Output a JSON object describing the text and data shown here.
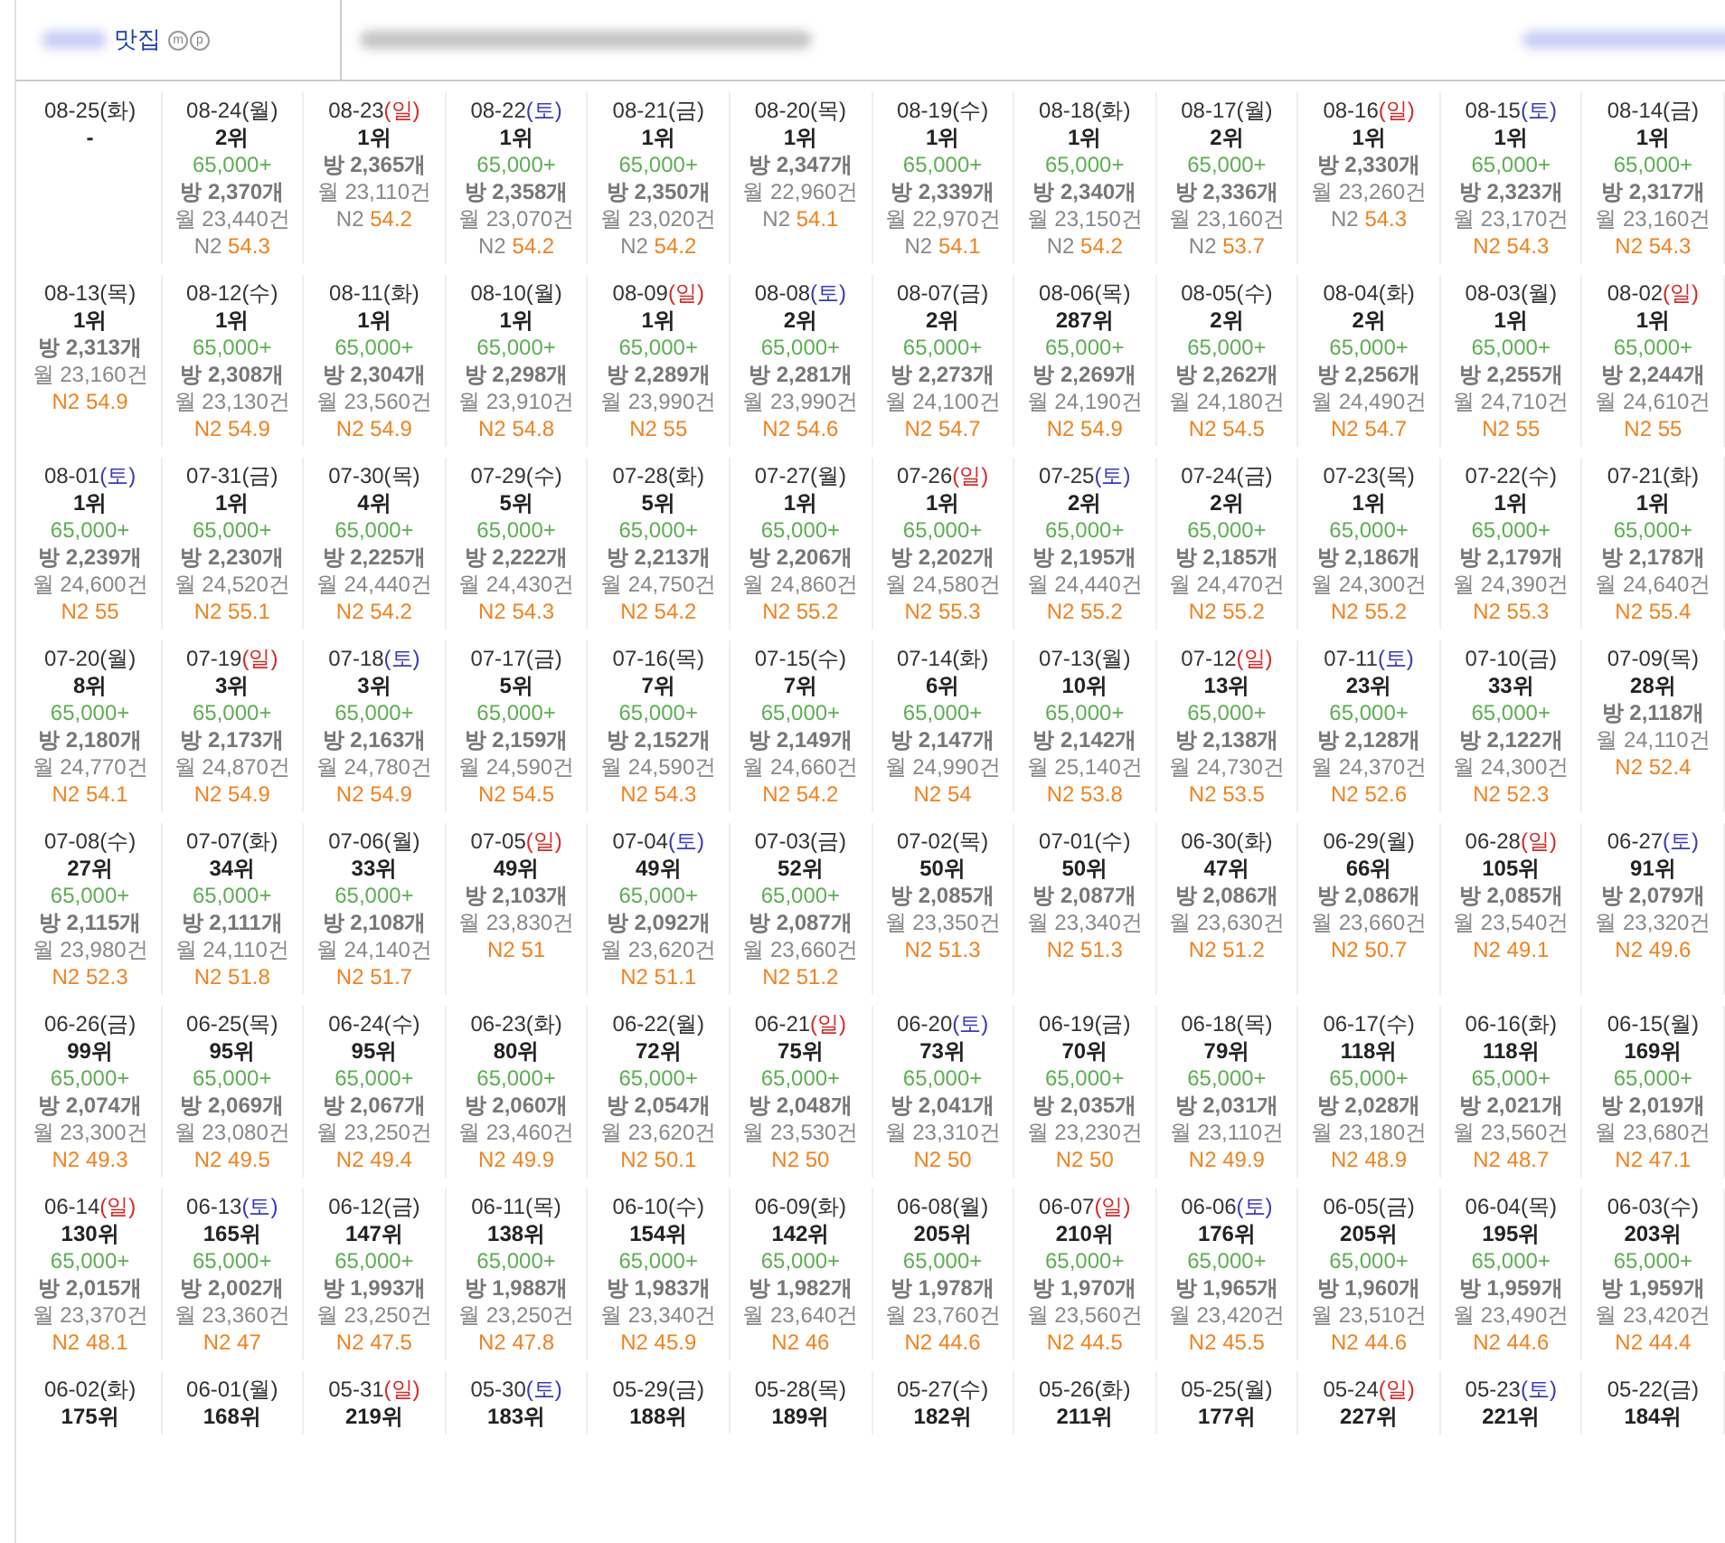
{
  "header": {
    "title": "맛집",
    "badges": [
      "m",
      "p"
    ]
  },
  "rows": [
    {
      "cells": [
        {
          "date": "08-25",
          "day": "(화)",
          "kind": "weekday",
          "rank": "-"
        },
        {
          "date": "08-24",
          "day": "(월)",
          "kind": "weekday",
          "rank": "2위",
          "price": "65,000+",
          "rooms": "방 2,370개",
          "monthly": "월 23,440건",
          "n2_label": "N2",
          "n2": "54.3",
          "n2_highlight": false
        },
        {
          "date": "08-23",
          "day": "(일)",
          "kind": "sun",
          "rank": "1위",
          "rooms": "방 2,365개",
          "monthly": "월 23,110건",
          "n2_label": "N2",
          "n2": "54.2",
          "n2_highlight": false
        },
        {
          "date": "08-22",
          "day": "(토)",
          "kind": "sat",
          "rank": "1위",
          "price": "65,000+",
          "rooms": "방 2,358개",
          "monthly": "월 23,070건",
          "n2_label": "N2",
          "n2": "54.2",
          "n2_highlight": false
        },
        {
          "date": "08-21",
          "day": "(금)",
          "kind": "weekday",
          "rank": "1위",
          "price": "65,000+",
          "rooms": "방 2,350개",
          "monthly": "월 23,020건",
          "n2_label": "N2",
          "n2": "54.2",
          "n2_highlight": false
        },
        {
          "date": "08-20",
          "day": "(목)",
          "kind": "weekday",
          "rank": "1위",
          "rooms": "방 2,347개",
          "monthly": "월 22,960건",
          "n2_label": "N2",
          "n2": "54.1",
          "n2_highlight": false
        },
        {
          "date": "08-19",
          "day": "(수)",
          "kind": "weekday",
          "rank": "1위",
          "price": "65,000+",
          "rooms": "방 2,339개",
          "monthly": "월 22,970건",
          "n2_label": "N2",
          "n2": "54.1",
          "n2_highlight": false
        },
        {
          "date": "08-18",
          "day": "(화)",
          "kind": "weekday",
          "rank": "1위",
          "price": "65,000+",
          "rooms": "방 2,340개",
          "monthly": "월 23,150건",
          "n2_label": "N2",
          "n2": "54.2",
          "n2_highlight": false
        },
        {
          "date": "08-17",
          "day": "(월)",
          "kind": "weekday",
          "rank": "2위",
          "price": "65,000+",
          "rooms": "방 2,336개",
          "monthly": "월 23,160건",
          "n2_label": "N2",
          "n2": "53.7",
          "n2_highlight": false
        },
        {
          "date": "08-16",
          "day": "(일)",
          "kind": "sun",
          "rank": "1위",
          "rooms": "방 2,330개",
          "monthly": "월 23,260건",
          "n2_label": "N2",
          "n2": "54.3",
          "n2_highlight": false
        },
        {
          "date": "08-15",
          "day": "(토)",
          "kind": "sat",
          "rank": "1위",
          "price": "65,000+",
          "rooms": "방 2,323개",
          "monthly": "월 23,170건",
          "n2_label": "N2",
          "n2": "54.3",
          "n2_highlight": true
        },
        {
          "date": "08-14",
          "day": "(금)",
          "kind": "weekday",
          "rank": "1위",
          "price": "65,000+",
          "rooms": "방 2,317개",
          "monthly": "월 23,160건",
          "n2_label": "N2",
          "n2": "54.3",
          "n2_highlight": true
        }
      ]
    },
    {
      "cells": [
        {
          "date": "08-13",
          "day": "(목)",
          "kind": "weekday",
          "rank": "1위",
          "rooms": "방 2,313개",
          "monthly": "월 23,160건",
          "n2_label": "N2",
          "n2": "54.9",
          "n2_highlight": true
        },
        {
          "date": "08-12",
          "day": "(수)",
          "kind": "weekday",
          "rank": "1위",
          "price": "65,000+",
          "rooms": "방 2,308개",
          "monthly": "월 23,130건",
          "n2_label": "N2",
          "n2": "54.9",
          "n2_highlight": true
        },
        {
          "date": "08-11",
          "day": "(화)",
          "kind": "weekday",
          "rank": "1위",
          "price": "65,000+",
          "rooms": "방 2,304개",
          "monthly": "월 23,560건",
          "n2_label": "N2",
          "n2": "54.9",
          "n2_highlight": true
        },
        {
          "date": "08-10",
          "day": "(월)",
          "kind": "weekday",
          "rank": "1위",
          "price": "65,000+",
          "rooms": "방 2,298개",
          "monthly": "월 23,910건",
          "n2_label": "N2",
          "n2": "54.8",
          "n2_highlight": true
        },
        {
          "date": "08-09",
          "day": "(일)",
          "kind": "sun",
          "rank": "1위",
          "price": "65,000+",
          "rooms": "방 2,289개",
          "monthly": "월 23,990건",
          "n2_label": "N2",
          "n2": "55",
          "n2_highlight": true
        },
        {
          "date": "08-08",
          "day": "(토)",
          "kind": "sat",
          "rank": "2위",
          "price": "65,000+",
          "rooms": "방 2,281개",
          "monthly": "월 23,990건",
          "n2_label": "N2",
          "n2": "54.6",
          "n2_highlight": true
        },
        {
          "date": "08-07",
          "day": "(금)",
          "kind": "weekday",
          "rank": "2위",
          "price": "65,000+",
          "rooms": "방 2,273개",
          "monthly": "월 24,100건",
          "n2_label": "N2",
          "n2": "54.7",
          "n2_highlight": true
        },
        {
          "date": "08-06",
          "day": "(목)",
          "kind": "weekday",
          "rank": "287위",
          "price": "65,000+",
          "rooms": "방 2,269개",
          "monthly": "월 24,190건",
          "n2_label": "N2",
          "n2": "54.9",
          "n2_highlight": true
        },
        {
          "date": "08-05",
          "day": "(수)",
          "kind": "weekday",
          "rank": "2위",
          "price": "65,000+",
          "rooms": "방 2,262개",
          "monthly": "월 24,180건",
          "n2_label": "N2",
          "n2": "54.5",
          "n2_highlight": true
        },
        {
          "date": "08-04",
          "day": "(화)",
          "kind": "weekday",
          "rank": "2위",
          "price": "65,000+",
          "rooms": "방 2,256개",
          "monthly": "월 24,490건",
          "n2_label": "N2",
          "n2": "54.7",
          "n2_highlight": true
        },
        {
          "date": "08-03",
          "day": "(월)",
          "kind": "weekday",
          "rank": "1위",
          "price": "65,000+",
          "rooms": "방 2,255개",
          "monthly": "월 24,710건",
          "n2_label": "N2",
          "n2": "55",
          "n2_highlight": true
        },
        {
          "date": "08-02",
          "day": "(일)",
          "kind": "sun",
          "rank": "1위",
          "price": "65,000+",
          "rooms": "방 2,244개",
          "monthly": "월 24,610건",
          "n2_label": "N2",
          "n2": "55",
          "n2_highlight": true
        }
      ]
    },
    {
      "cells": [
        {
          "date": "08-01",
          "day": "(토)",
          "kind": "sat",
          "rank": "1위",
          "price": "65,000+",
          "rooms": "방 2,239개",
          "monthly": "월 24,600건",
          "n2_label": "N2",
          "n2": "55",
          "n2_highlight": true
        },
        {
          "date": "07-31",
          "day": "(금)",
          "kind": "weekday",
          "rank": "1위",
          "price": "65,000+",
          "rooms": "방 2,230개",
          "monthly": "월 24,520건",
          "n2_label": "N2",
          "n2": "55.1",
          "n2_highlight": true
        },
        {
          "date": "07-30",
          "day": "(목)",
          "kind": "weekday",
          "rank": "4위",
          "price": "65,000+",
          "rooms": "방 2,225개",
          "monthly": "월 24,440건",
          "n2_label": "N2",
          "n2": "54.2",
          "n2_highlight": true
        },
        {
          "date": "07-29",
          "day": "(수)",
          "kind": "weekday",
          "rank": "5위",
          "price": "65,000+",
          "rooms": "방 2,222개",
          "monthly": "월 24,430건",
          "n2_label": "N2",
          "n2": "54.3",
          "n2_highlight": true
        },
        {
          "date": "07-28",
          "day": "(화)",
          "kind": "weekday",
          "rank": "5위",
          "price": "65,000+",
          "rooms": "방 2,213개",
          "monthly": "월 24,750건",
          "n2_label": "N2",
          "n2": "54.2",
          "n2_highlight": true
        },
        {
          "date": "07-27",
          "day": "(월)",
          "kind": "weekday",
          "rank": "1위",
          "price": "65,000+",
          "rooms": "방 2,206개",
          "monthly": "월 24,860건",
          "n2_label": "N2",
          "n2": "55.2",
          "n2_highlight": true
        },
        {
          "date": "07-26",
          "day": "(일)",
          "kind": "sun",
          "rank": "1위",
          "price": "65,000+",
          "rooms": "방 2,202개",
          "monthly": "월 24,580건",
          "n2_label": "N2",
          "n2": "55.3",
          "n2_highlight": true
        },
        {
          "date": "07-25",
          "day": "(토)",
          "kind": "sat",
          "rank": "2위",
          "price": "65,000+",
          "rooms": "방 2,195개",
          "monthly": "월 24,440건",
          "n2_label": "N2",
          "n2": "55.2",
          "n2_highlight": true
        },
        {
          "date": "07-24",
          "day": "(금)",
          "kind": "weekday",
          "rank": "2위",
          "price": "65,000+",
          "rooms": "방 2,185개",
          "monthly": "월 24,470건",
          "n2_label": "N2",
          "n2": "55.2",
          "n2_highlight": true
        },
        {
          "date": "07-23",
          "day": "(목)",
          "kind": "weekday",
          "rank": "1위",
          "price": "65,000+",
          "rooms": "방 2,186개",
          "monthly": "월 24,300건",
          "n2_label": "N2",
          "n2": "55.2",
          "n2_highlight": true
        },
        {
          "date": "07-22",
          "day": "(수)",
          "kind": "weekday",
          "rank": "1위",
          "price": "65,000+",
          "rooms": "방 2,179개",
          "monthly": "월 24,390건",
          "n2_label": "N2",
          "n2": "55.3",
          "n2_highlight": true
        },
        {
          "date": "07-21",
          "day": "(화)",
          "kind": "weekday",
          "rank": "1위",
          "price": "65,000+",
          "rooms": "방 2,178개",
          "monthly": "월 24,640건",
          "n2_label": "N2",
          "n2": "55.4",
          "n2_highlight": true
        }
      ]
    },
    {
      "cells": [
        {
          "date": "07-20",
          "day": "(월)",
          "kind": "weekday",
          "rank": "8위",
          "price": "65,000+",
          "rooms": "방 2,180개",
          "monthly": "월 24,770건",
          "n2_label": "N2",
          "n2": "54.1",
          "n2_highlight": true
        },
        {
          "date": "07-19",
          "day": "(일)",
          "kind": "sun",
          "rank": "3위",
          "price": "65,000+",
          "rooms": "방 2,173개",
          "monthly": "월 24,870건",
          "n2_label": "N2",
          "n2": "54.9",
          "n2_highlight": true
        },
        {
          "date": "07-18",
          "day": "(토)",
          "kind": "sat",
          "rank": "3위",
          "price": "65,000+",
          "rooms": "방 2,163개",
          "monthly": "월 24,780건",
          "n2_label": "N2",
          "n2": "54.9",
          "n2_highlight": true
        },
        {
          "date": "07-17",
          "day": "(금)",
          "kind": "weekday",
          "rank": "5위",
          "price": "65,000+",
          "rooms": "방 2,159개",
          "monthly": "월 24,590건",
          "n2_label": "N2",
          "n2": "54.5",
          "n2_highlight": true
        },
        {
          "date": "07-16",
          "day": "(목)",
          "kind": "weekday",
          "rank": "7위",
          "price": "65,000+",
          "rooms": "방 2,152개",
          "monthly": "월 24,590건",
          "n2_label": "N2",
          "n2": "54.3",
          "n2_highlight": true
        },
        {
          "date": "07-15",
          "day": "(수)",
          "kind": "weekday",
          "rank": "7위",
          "price": "65,000+",
          "rooms": "방 2,149개",
          "monthly": "월 24,660건",
          "n2_label": "N2",
          "n2": "54.2",
          "n2_highlight": true
        },
        {
          "date": "07-14",
          "day": "(화)",
          "kind": "weekday",
          "rank": "6위",
          "price": "65,000+",
          "rooms": "방 2,147개",
          "monthly": "월 24,990건",
          "n2_label": "N2",
          "n2": "54",
          "n2_highlight": true
        },
        {
          "date": "07-13",
          "day": "(월)",
          "kind": "weekday",
          "rank": "10위",
          "price": "65,000+",
          "rooms": "방 2,142개",
          "monthly": "월 25,140건",
          "n2_label": "N2",
          "n2": "53.8",
          "n2_highlight": true
        },
        {
          "date": "07-12",
          "day": "(일)",
          "kind": "sun",
          "rank": "13위",
          "price": "65,000+",
          "rooms": "방 2,138개",
          "monthly": "월 24,730건",
          "n2_label": "N2",
          "n2": "53.5",
          "n2_highlight": true
        },
        {
          "date": "07-11",
          "day": "(토)",
          "kind": "sat",
          "rank": "23위",
          "price": "65,000+",
          "rooms": "방 2,128개",
          "monthly": "월 24,370건",
          "n2_label": "N2",
          "n2": "52.6",
          "n2_highlight": true
        },
        {
          "date": "07-10",
          "day": "(금)",
          "kind": "weekday",
          "rank": "33위",
          "price": "65,000+",
          "rooms": "방 2,122개",
          "monthly": "월 24,300건",
          "n2_label": "N2",
          "n2": "52.3",
          "n2_highlight": true
        },
        {
          "date": "07-09",
          "day": "(목)",
          "kind": "weekday",
          "rank": "28위",
          "rooms": "방 2,118개",
          "monthly": "월 24,110건",
          "n2_label": "N2",
          "n2": "52.4",
          "n2_highlight": true
        }
      ]
    },
    {
      "cells": [
        {
          "date": "07-08",
          "day": "(수)",
          "kind": "weekday",
          "rank": "27위",
          "price": "65,000+",
          "rooms": "방 2,115개",
          "monthly": "월 23,980건",
          "n2_label": "N2",
          "n2": "52.3",
          "n2_highlight": true
        },
        {
          "date": "07-07",
          "day": "(화)",
          "kind": "weekday",
          "rank": "34위",
          "price": "65,000+",
          "rooms": "방 2,111개",
          "monthly": "월 24,110건",
          "n2_label": "N2",
          "n2": "51.8",
          "n2_highlight": true
        },
        {
          "date": "07-06",
          "day": "(월)",
          "kind": "weekday",
          "rank": "33위",
          "price": "65,000+",
          "rooms": "방 2,108개",
          "monthly": "월 24,140건",
          "n2_label": "N2",
          "n2": "51.7",
          "n2_highlight": true
        },
        {
          "date": "07-05",
          "day": "(일)",
          "kind": "sun",
          "rank": "49위",
          "rooms": "방 2,103개",
          "monthly": "월 23,830건",
          "n2_label": "N2",
          "n2": "51",
          "n2_highlight": true
        },
        {
          "date": "07-04",
          "day": "(토)",
          "kind": "sat",
          "rank": "49위",
          "price": "65,000+",
          "rooms": "방 2,092개",
          "monthly": "월 23,620건",
          "n2_label": "N2",
          "n2": "51.1",
          "n2_highlight": true
        },
        {
          "date": "07-03",
          "day": "(금)",
          "kind": "weekday",
          "rank": "52위",
          "price": "65,000+",
          "rooms": "방 2,087개",
          "monthly": "월 23,660건",
          "n2_label": "N2",
          "n2": "51.2",
          "n2_highlight": true
        },
        {
          "date": "07-02",
          "day": "(목)",
          "kind": "weekday",
          "rank": "50위",
          "rooms": "방 2,085개",
          "monthly": "월 23,350건",
          "n2_label": "N2",
          "n2": "51.3",
          "n2_highlight": true
        },
        {
          "date": "07-01",
          "day": "(수)",
          "kind": "weekday",
          "rank": "50위",
          "rooms": "방 2,087개",
          "monthly": "월 23,340건",
          "n2_label": "N2",
          "n2": "51.3",
          "n2_highlight": true
        },
        {
          "date": "06-30",
          "day": "(화)",
          "kind": "weekday",
          "rank": "47위",
          "rooms": "방 2,086개",
          "monthly": "월 23,630건",
          "n2_label": "N2",
          "n2": "51.2",
          "n2_highlight": true
        },
        {
          "date": "06-29",
          "day": "(월)",
          "kind": "weekday",
          "rank": "66위",
          "rooms": "방 2,086개",
          "monthly": "월 23,660건",
          "n2_label": "N2",
          "n2": "50.7",
          "n2_highlight": true
        },
        {
          "date": "06-28",
          "day": "(일)",
          "kind": "sun",
          "rank": "105위",
          "rooms": "방 2,085개",
          "monthly": "월 23,540건",
          "n2_label": "N2",
          "n2": "49.1",
          "n2_highlight": true
        },
        {
          "date": "06-27",
          "day": "(토)",
          "kind": "sat",
          "rank": "91위",
          "rooms": "방 2,079개",
          "monthly": "월 23,320건",
          "n2_label": "N2",
          "n2": "49.6",
          "n2_highlight": true
        }
      ]
    },
    {
      "cells": [
        {
          "date": "06-26",
          "day": "(금)",
          "kind": "weekday",
          "rank": "99위",
          "price": "65,000+",
          "rooms": "방 2,074개",
          "monthly": "월 23,300건",
          "n2_label": "N2",
          "n2": "49.3",
          "n2_highlight": true
        },
        {
          "date": "06-25",
          "day": "(목)",
          "kind": "weekday",
          "rank": "95위",
          "price": "65,000+",
          "rooms": "방 2,069개",
          "monthly": "월 23,080건",
          "n2_label": "N2",
          "n2": "49.5",
          "n2_highlight": true
        },
        {
          "date": "06-24",
          "day": "(수)",
          "kind": "weekday",
          "rank": "95위",
          "price": "65,000+",
          "rooms": "방 2,067개",
          "monthly": "월 23,250건",
          "n2_label": "N2",
          "n2": "49.4",
          "n2_highlight": true
        },
        {
          "date": "06-23",
          "day": "(화)",
          "kind": "weekday",
          "rank": "80위",
          "price": "65,000+",
          "rooms": "방 2,060개",
          "monthly": "월 23,460건",
          "n2_label": "N2",
          "n2": "49.9",
          "n2_highlight": true
        },
        {
          "date": "06-22",
          "day": "(월)",
          "kind": "weekday",
          "rank": "72위",
          "price": "65,000+",
          "rooms": "방 2,054개",
          "monthly": "월 23,620건",
          "n2_label": "N2",
          "n2": "50.1",
          "n2_highlight": true
        },
        {
          "date": "06-21",
          "day": "(일)",
          "kind": "sun",
          "rank": "75위",
          "price": "65,000+",
          "rooms": "방 2,048개",
          "monthly": "월 23,530건",
          "n2_label": "N2",
          "n2": "50",
          "n2_highlight": true
        },
        {
          "date": "06-20",
          "day": "(토)",
          "kind": "sat",
          "rank": "73위",
          "price": "65,000+",
          "rooms": "방 2,041개",
          "monthly": "월 23,310건",
          "n2_label": "N2",
          "n2": "50",
          "n2_highlight": true
        },
        {
          "date": "06-19",
          "day": "(금)",
          "kind": "weekday",
          "rank": "70위",
          "price": "65,000+",
          "rooms": "방 2,035개",
          "monthly": "월 23,230건",
          "n2_label": "N2",
          "n2": "50",
          "n2_highlight": true
        },
        {
          "date": "06-18",
          "day": "(목)",
          "kind": "weekday",
          "rank": "79위",
          "price": "65,000+",
          "rooms": "방 2,031개",
          "monthly": "월 23,110건",
          "n2_label": "N2",
          "n2": "49.9",
          "n2_highlight": true
        },
        {
          "date": "06-17",
          "day": "(수)",
          "kind": "weekday",
          "rank": "118위",
          "price": "65,000+",
          "rooms": "방 2,028개",
          "monthly": "월 23,180건",
          "n2_label": "N2",
          "n2": "48.9",
          "n2_highlight": true
        },
        {
          "date": "06-16",
          "day": "(화)",
          "kind": "weekday",
          "rank": "118위",
          "price": "65,000+",
          "rooms": "방 2,021개",
          "monthly": "월 23,560건",
          "n2_label": "N2",
          "n2": "48.7",
          "n2_highlight": true
        },
        {
          "date": "06-15",
          "day": "(월)",
          "kind": "weekday",
          "rank": "169위",
          "price": "65,000+",
          "rooms": "방 2,019개",
          "monthly": "월 23,680건",
          "n2_label": "N2",
          "n2": "47.1",
          "n2_highlight": true
        }
      ]
    },
    {
      "cells": [
        {
          "date": "06-14",
          "day": "(일)",
          "kind": "sun",
          "rank": "130위",
          "price": "65,000+",
          "rooms": "방 2,015개",
          "monthly": "월 23,370건",
          "n2_label": "N2",
          "n2": "48.1",
          "n2_highlight": true
        },
        {
          "date": "06-13",
          "day": "(토)",
          "kind": "sat",
          "rank": "165위",
          "price": "65,000+",
          "rooms": "방 2,002개",
          "monthly": "월 23,360건",
          "n2_label": "N2",
          "n2": "47",
          "n2_highlight": true
        },
        {
          "date": "06-12",
          "day": "(금)",
          "kind": "weekday",
          "rank": "147위",
          "price": "65,000+",
          "rooms": "방 1,993개",
          "monthly": "월 23,250건",
          "n2_label": "N2",
          "n2": "47.5",
          "n2_highlight": true
        },
        {
          "date": "06-11",
          "day": "(목)",
          "kind": "weekday",
          "rank": "138위",
          "price": "65,000+",
          "rooms": "방 1,988개",
          "monthly": "월 23,250건",
          "n2_label": "N2",
          "n2": "47.8",
          "n2_highlight": true
        },
        {
          "date": "06-10",
          "day": "(수)",
          "kind": "weekday",
          "rank": "154위",
          "price": "65,000+",
          "rooms": "방 1,983개",
          "monthly": "월 23,340건",
          "n2_label": "N2",
          "n2": "45.9",
          "n2_highlight": true
        },
        {
          "date": "06-09",
          "day": "(화)",
          "kind": "weekday",
          "rank": "142위",
          "price": "65,000+",
          "rooms": "방 1,982개",
          "monthly": "월 23,640건",
          "n2_label": "N2",
          "n2": "46",
          "n2_highlight": true
        },
        {
          "date": "06-08",
          "day": "(월)",
          "kind": "weekday",
          "rank": "205위",
          "price": "65,000+",
          "rooms": "방 1,978개",
          "monthly": "월 23,760건",
          "n2_label": "N2",
          "n2": "44.6",
          "n2_highlight": true
        },
        {
          "date": "06-07",
          "day": "(일)",
          "kind": "sun",
          "rank": "210위",
          "price": "65,000+",
          "rooms": "방 1,970개",
          "monthly": "월 23,560건",
          "n2_label": "N2",
          "n2": "44.5",
          "n2_highlight": true
        },
        {
          "date": "06-06",
          "day": "(토)",
          "kind": "sat",
          "rank": "176위",
          "price": "65,000+",
          "rooms": "방 1,965개",
          "monthly": "월 23,420건",
          "n2_label": "N2",
          "n2": "45.5",
          "n2_highlight": true
        },
        {
          "date": "06-05",
          "day": "(금)",
          "kind": "weekday",
          "rank": "205위",
          "price": "65,000+",
          "rooms": "방 1,960개",
          "monthly": "월 23,510건",
          "n2_label": "N2",
          "n2": "44.6",
          "n2_highlight": true
        },
        {
          "date": "06-04",
          "day": "(목)",
          "kind": "weekday",
          "rank": "195위",
          "price": "65,000+",
          "rooms": "방 1,959개",
          "monthly": "월 23,490건",
          "n2_label": "N2",
          "n2": "44.6",
          "n2_highlight": true
        },
        {
          "date": "06-03",
          "day": "(수)",
          "kind": "weekday",
          "rank": "203위",
          "price": "65,000+",
          "rooms": "방 1,959개",
          "monthly": "월 23,420건",
          "n2_label": "N2",
          "n2": "44.4",
          "n2_highlight": true
        }
      ]
    },
    {
      "cells": [
        {
          "date": "06-02",
          "day": "(화)",
          "kind": "weekday",
          "rank": "175위"
        },
        {
          "date": "06-01",
          "day": "(월)",
          "kind": "weekday",
          "rank": "168위"
        },
        {
          "date": "05-31",
          "day": "(일)",
          "kind": "sun",
          "rank": "219위"
        },
        {
          "date": "05-30",
          "day": "(토)",
          "kind": "sat",
          "rank": "183위"
        },
        {
          "date": "05-29",
          "day": "(금)",
          "kind": "weekday",
          "rank": "188위"
        },
        {
          "date": "05-28",
          "day": "(목)",
          "kind": "weekday",
          "rank": "189위"
        },
        {
          "date": "05-27",
          "day": "(수)",
          "kind": "weekday",
          "rank": "182위"
        },
        {
          "date": "05-26",
          "day": "(화)",
          "kind": "weekday",
          "rank": "211위"
        },
        {
          "date": "05-25",
          "day": "(월)",
          "kind": "weekday",
          "rank": "177위"
        },
        {
          "date": "05-24",
          "day": "(일)",
          "kind": "sun",
          "rank": "227위"
        },
        {
          "date": "05-23",
          "day": "(토)",
          "kind": "sat",
          "rank": "221위"
        },
        {
          "date": "05-22",
          "day": "(금)",
          "kind": "weekday",
          "rank": "184위"
        }
      ]
    }
  ]
}
